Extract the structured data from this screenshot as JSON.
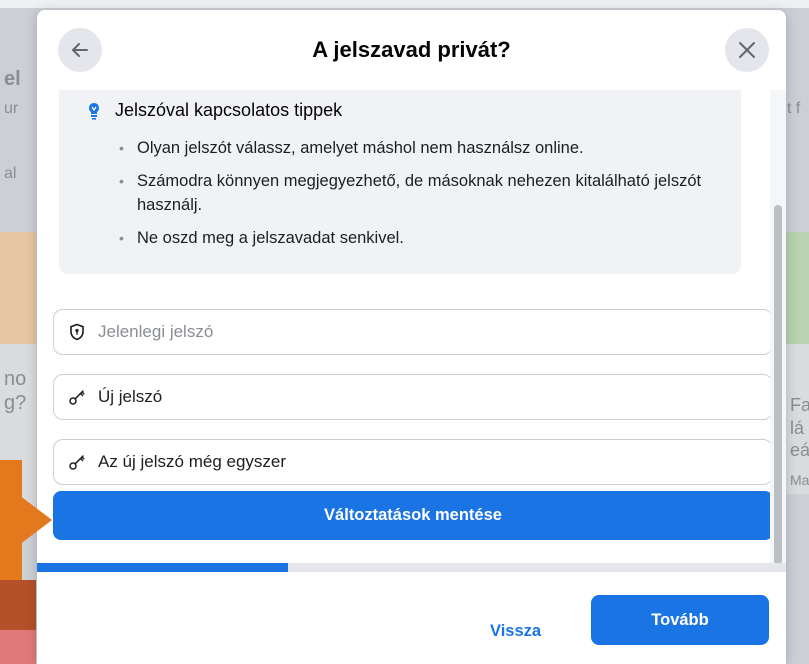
{
  "modal": {
    "title": "A jelszavad privát?",
    "back_icon": "arrow-left-icon",
    "close_icon": "close-icon"
  },
  "tips": {
    "title": "Jelszóval kapcsolatos tippek",
    "icon": "lightbulb-icon",
    "items": [
      "Olyan jelszót válassz, amelyet máshol nem használsz online.",
      "Számodra könnyen megjegyezhető, de másoknak nehezen kitalálható jelszót használj.",
      "Ne oszd meg a jelszavadat senkivel."
    ]
  },
  "form": {
    "current_password_placeholder": "Jelenlegi jelszó",
    "new_password_label": "Új jelszó",
    "confirm_password_label": "Az új jelszó még egyszer",
    "save_button": "Változtatások mentése"
  },
  "progress": {
    "value": 0.335
  },
  "footer": {
    "back_label": "Vissza",
    "next_label": "Tovább"
  },
  "background": {
    "frag1": "el",
    "frag2": "ur",
    "frag3": "al",
    "frag4": "t f",
    "frag5": "no",
    "frag6": "g?",
    "frag7": "Fa",
    "frag8": "lá",
    "frag9": "eá",
    "frag10": "Ma"
  },
  "colors": {
    "accent": "#1b74e4",
    "tips_background": "#f0f2f5",
    "arrow_annotation": "#e3791c"
  }
}
